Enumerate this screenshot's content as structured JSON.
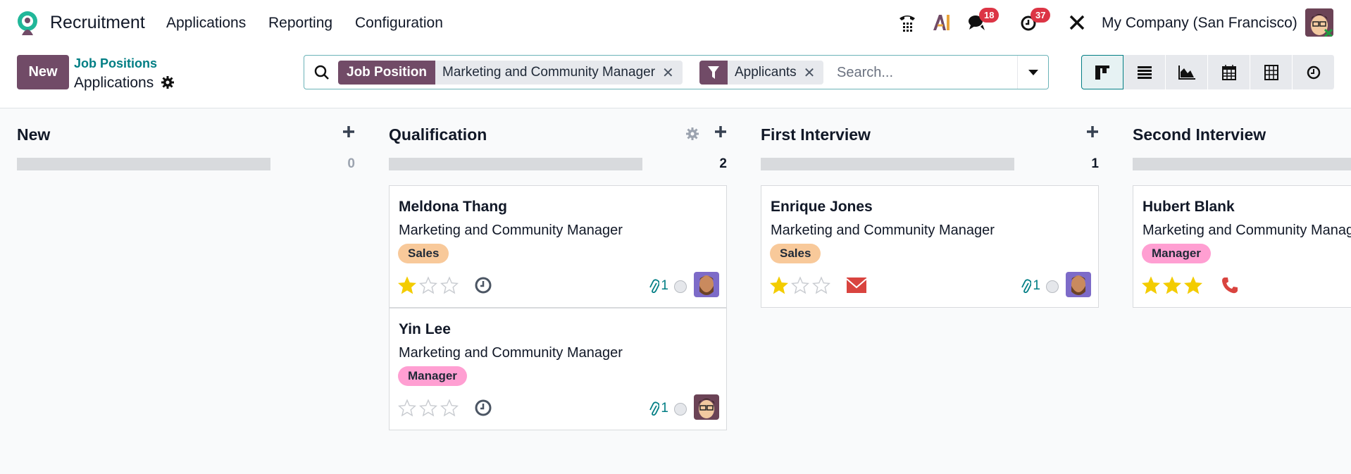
{
  "nav": {
    "app_name": "Recruitment",
    "menu": [
      "Applications",
      "Reporting",
      "Configuration"
    ],
    "messages_count": "18",
    "activities_count": "37",
    "company": "My Company (San Francisco)"
  },
  "control": {
    "new_label": "New",
    "breadcrumb_parent": "Job Positions",
    "breadcrumb_current": "Applications"
  },
  "search": {
    "facets": [
      {
        "label": "Job Position",
        "value": "Marketing and Community Manager"
      },
      {
        "icon": "filter-icon",
        "value": "Applicants"
      }
    ],
    "placeholder": "Search..."
  },
  "views": [
    "kanban",
    "list",
    "graph",
    "calendar",
    "pivot",
    "activity"
  ],
  "colors": {
    "brand": "#714b67",
    "teal": "#017e84",
    "star": "#f3cc00",
    "sales_tag": "#f8c99a",
    "manager_tag": "#ff9fd2",
    "danger": "#dc3545"
  },
  "columns": [
    {
      "title": "New",
      "count": "0",
      "cards": []
    },
    {
      "title": "Qualification",
      "count": "2",
      "cards": [
        {
          "name": "Meldona Thang",
          "job": "Marketing and Community Manager",
          "tag": "Sales",
          "stars": 1,
          "activity": "clock-icon",
          "attachments": "1",
          "avatar": "bearded-man"
        },
        {
          "name": "Yin Lee",
          "job": "Marketing and Community Manager",
          "tag": "Manager",
          "stars": 0,
          "activity": "clock-icon",
          "attachments": "1",
          "avatar": "glasses-man"
        }
      ]
    },
    {
      "title": "First Interview",
      "count": "1",
      "cards": [
        {
          "name": "Enrique Jones",
          "job": "Marketing and Community Manager",
          "tag": "Sales",
          "stars": 1,
          "activity": "envelope-icon",
          "attachments": "1",
          "avatar": "bearded-man"
        }
      ]
    },
    {
      "title": "Second Interview",
      "cards": [
        {
          "name": "Hubert Blank",
          "job": "Marketing and Community Manager",
          "tag": "Manager",
          "stars": 3,
          "activity": "phone-icon"
        }
      ]
    }
  ]
}
